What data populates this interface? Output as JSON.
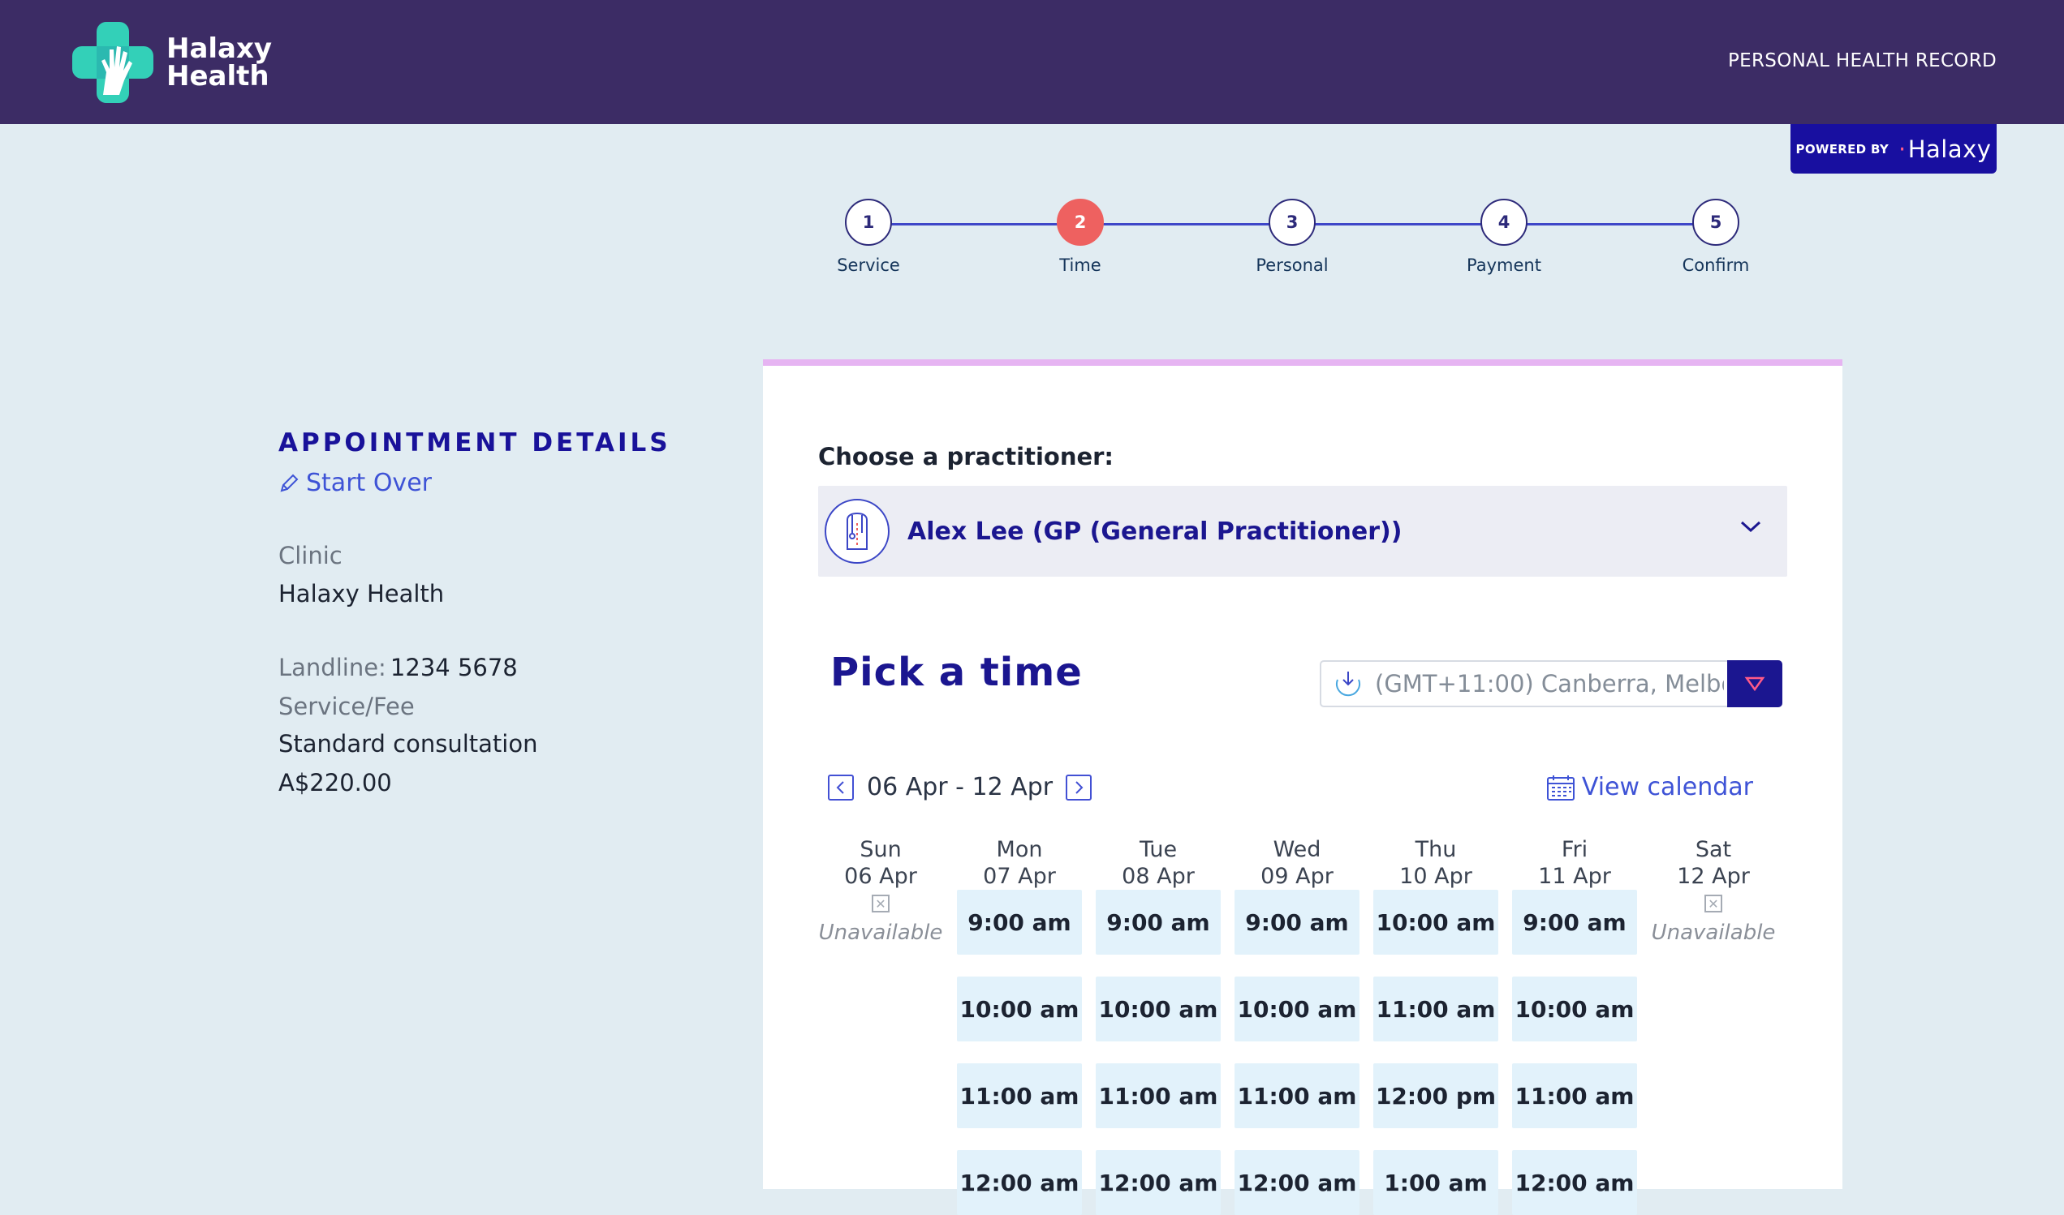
{
  "header": {
    "logo_line1": "Halaxy",
    "logo_line2": "Health",
    "phr_label": "PERSONAL HEALTH RECORD",
    "powered_by": "POWERED BY",
    "powered_brand": "Halaxy",
    "bg_color": "#3c2c65"
  },
  "steps": [
    {
      "num": "1",
      "label": "Service"
    },
    {
      "num": "2",
      "label": "Time"
    },
    {
      "num": "3",
      "label": "Personal"
    },
    {
      "num": "4",
      "label": "Payment"
    },
    {
      "num": "5",
      "label": "Confirm"
    }
  ],
  "active_step": "2",
  "details": {
    "title": "APPOINTMENT DETAILS",
    "start_over": "Start Over",
    "clinic_label": "Clinic",
    "clinic_value": "Halaxy Health",
    "landline_label": "Landline:",
    "landline_value": "1234 5678",
    "service_label": "Service/Fee",
    "service_value": "Standard consultation",
    "fee_value": "A$220.00"
  },
  "booking": {
    "choose_label": "Choose a practitioner:",
    "practitioner": "Alex Lee (GP (General Practitioner))",
    "pick_title": "Pick a time",
    "timezone": "(GMT+11:00) Canberra, Melbo",
    "week_range": "06 Apr - 12 Apr",
    "view_calendar": "View calendar",
    "unavailable": "Unavailable"
  },
  "days": [
    {
      "day": "Sun",
      "date": "06 Apr",
      "slots": [],
      "unavailable": true
    },
    {
      "day": "Mon",
      "date": "07 Apr",
      "slots": [
        "9:00 am",
        "10:00 am",
        "11:00 am",
        "12:00 am"
      ]
    },
    {
      "day": "Tue",
      "date": "08 Apr",
      "slots": [
        "9:00 am",
        "10:00 am",
        "11:00 am",
        "12:00 am"
      ]
    },
    {
      "day": "Wed",
      "date": "09 Apr",
      "slots": [
        "9:00 am",
        "10:00 am",
        "11:00 am",
        "12:00 am"
      ]
    },
    {
      "day": "Thu",
      "date": "10 Apr",
      "slots": [
        "10:00 am",
        "11:00 am",
        "12:00 pm",
        "1:00 am"
      ]
    },
    {
      "day": "Fri",
      "date": "11 Apr",
      "slots": [
        "9:00 am",
        "10:00 am",
        "11:00 am",
        "12:00 am"
      ]
    },
    {
      "day": "Sat",
      "date": "12 Apr",
      "slots": [],
      "unavailable": true
    }
  ],
  "colors": {
    "accent": "#1b1690",
    "link": "#3e53d6",
    "active_step": "#ee6160",
    "slot_bg": "#e2f2fb",
    "page_bg": "#e1ecf2"
  }
}
